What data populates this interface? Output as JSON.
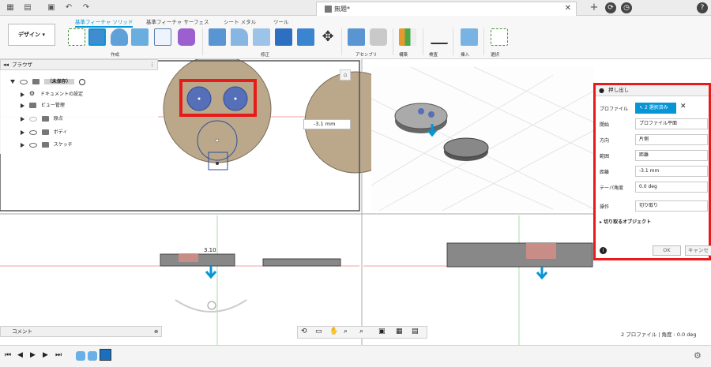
{
  "window": {
    "doc_title": "無題*"
  },
  "ribbon": {
    "design_button": "デザイン",
    "tabs": [
      "基準フィーチャ ソリッド",
      "基準フィーチャ サーフェス",
      "シート メタル",
      "ツール"
    ],
    "groups": [
      "作成",
      "修正",
      "アセンブリ",
      "構築",
      "検査",
      "挿入",
      "選択"
    ]
  },
  "browser": {
    "title": "ブラウザ",
    "root": "（未保存）",
    "items": [
      "ドキュメントの設定",
      "ビュー管理",
      "原点",
      "ボディ",
      "スケッチ"
    ]
  },
  "viewport": {
    "distance_input": "-3.1 mm",
    "dim_label": "3.10"
  },
  "dialog": {
    "title": "押し出し",
    "rows": [
      {
        "label": "プロファイル",
        "value": "2 選択済み"
      },
      {
        "label": "開始",
        "value": "プロファイル平面"
      },
      {
        "label": "方向",
        "value": "片側"
      },
      {
        "label": "範囲",
        "value": "距離"
      },
      {
        "label": "距離",
        "value": "-3.1 mm"
      },
      {
        "label": "テーパ角度",
        "value": "0.0 deg"
      },
      {
        "label": "操作",
        "value": "切り取り"
      }
    ],
    "objects_section": "切り取るオブジェクト",
    "ok": "OK",
    "cancel": "キャンセル"
  },
  "comment_bar": "コメント",
  "status": "2 プロファイル | 角度 : 0.0 deg",
  "colors": {
    "accent": "#0696d7",
    "highlight": "#e81a1a",
    "body": "#bba88a",
    "profile": "#5570b8"
  }
}
